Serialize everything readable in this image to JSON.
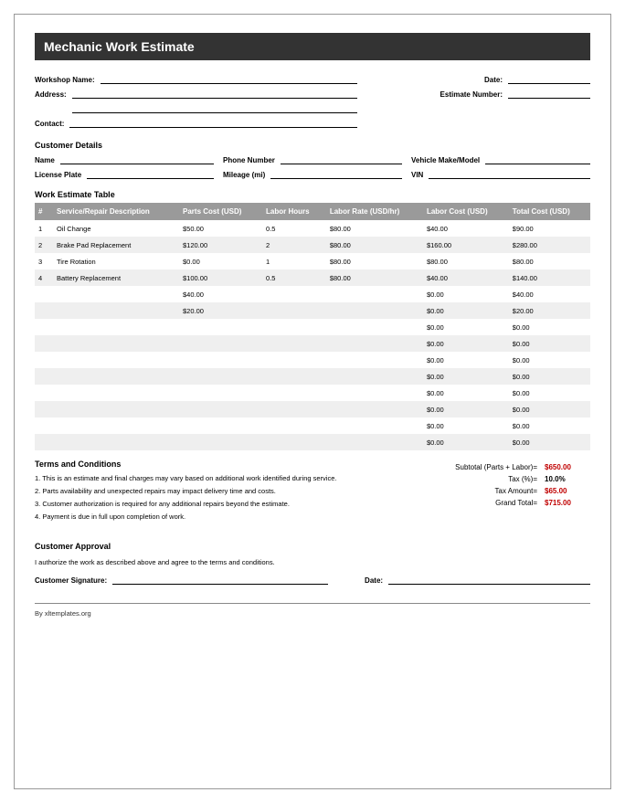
{
  "title": "Mechanic Work Estimate",
  "header_left": {
    "workshop_name": "Workshop Name:",
    "address": "Address:",
    "contact": "Contact:"
  },
  "header_right": {
    "date": "Date:",
    "estimate_number": "Estimate Number:"
  },
  "customer_section": "Customer Details",
  "customer": {
    "name": "Name",
    "phone": "Phone Number",
    "vehicle": "Vehicle Make/Model",
    "license": "License Plate",
    "mileage": "Mileage (mi)",
    "vin": "VIN"
  },
  "work_table_title": "Work Estimate Table",
  "columns": {
    "num": "#",
    "desc": "Service/Repair Description",
    "parts": "Parts Cost (USD)",
    "hours": "Labor Hours",
    "rate": "Labor Rate (USD/hr)",
    "labor": "Labor Cost (USD)",
    "total": "Total Cost (USD)"
  },
  "rows": [
    {
      "num": "1",
      "desc": "Oil Change",
      "parts": "$50.00",
      "hours": "0.5",
      "rate": "$80.00",
      "labor": "$40.00",
      "total": "$90.00"
    },
    {
      "num": "2",
      "desc": "Brake Pad Replacement",
      "parts": "$120.00",
      "hours": "2",
      "rate": "$80.00",
      "labor": "$160.00",
      "total": "$280.00"
    },
    {
      "num": "3",
      "desc": "Tire Rotation",
      "parts": "$0.00",
      "hours": "1",
      "rate": "$80.00",
      "labor": "$80.00",
      "total": "$80.00"
    },
    {
      "num": "4",
      "desc": "Battery Replacement",
      "parts": "$100.00",
      "hours": "0.5",
      "rate": "$80.00",
      "labor": "$40.00",
      "total": "$140.00"
    },
    {
      "num": "",
      "desc": "",
      "parts": "$40.00",
      "hours": "",
      "rate": "",
      "labor": "$0.00",
      "total": "$40.00"
    },
    {
      "num": "",
      "desc": "",
      "parts": "$20.00",
      "hours": "",
      "rate": "",
      "labor": "$0.00",
      "total": "$20.00"
    },
    {
      "num": "",
      "desc": "",
      "parts": "",
      "hours": "",
      "rate": "",
      "labor": "$0.00",
      "total": "$0.00"
    },
    {
      "num": "",
      "desc": "",
      "parts": "",
      "hours": "",
      "rate": "",
      "labor": "$0.00",
      "total": "$0.00"
    },
    {
      "num": "",
      "desc": "",
      "parts": "",
      "hours": "",
      "rate": "",
      "labor": "$0.00",
      "total": "$0.00"
    },
    {
      "num": "",
      "desc": "",
      "parts": "",
      "hours": "",
      "rate": "",
      "labor": "$0.00",
      "total": "$0.00"
    },
    {
      "num": "",
      "desc": "",
      "parts": "",
      "hours": "",
      "rate": "",
      "labor": "$0.00",
      "total": "$0.00"
    },
    {
      "num": "",
      "desc": "",
      "parts": "",
      "hours": "",
      "rate": "",
      "labor": "$0.00",
      "total": "$0.00"
    },
    {
      "num": "",
      "desc": "",
      "parts": "",
      "hours": "",
      "rate": "",
      "labor": "$0.00",
      "total": "$0.00"
    },
    {
      "num": "",
      "desc": "",
      "parts": "",
      "hours": "",
      "rate": "",
      "labor": "$0.00",
      "total": "$0.00"
    }
  ],
  "terms_title": "Terms and Conditions",
  "terms": [
    "1. This is an estimate and final charges may vary based on additional work identified during service.",
    "2. Parts availability and unexpected repairs may impact delivery time and costs.",
    "3. Customer authorization is required for any additional repairs beyond the estimate.",
    "4. Payment is due in full upon completion of work."
  ],
  "totals": {
    "subtotal_label": "Subtotal (Parts + Labor)=",
    "subtotal_val": "$650.00",
    "tax_pct_label": "Tax (%)=",
    "tax_pct_val": "10.0%",
    "tax_amt_label": "Tax Amount=",
    "tax_amt_val": "$65.00",
    "grand_label": "Grand Total=",
    "grand_val": "$715.00"
  },
  "approval_title": "Customer Approval",
  "approval_text": "I authorize the work as described above and agree to the terms and conditions.",
  "approval_sig": "Customer Signature:",
  "approval_date": "Date:",
  "footer": "By xltemplates.org"
}
